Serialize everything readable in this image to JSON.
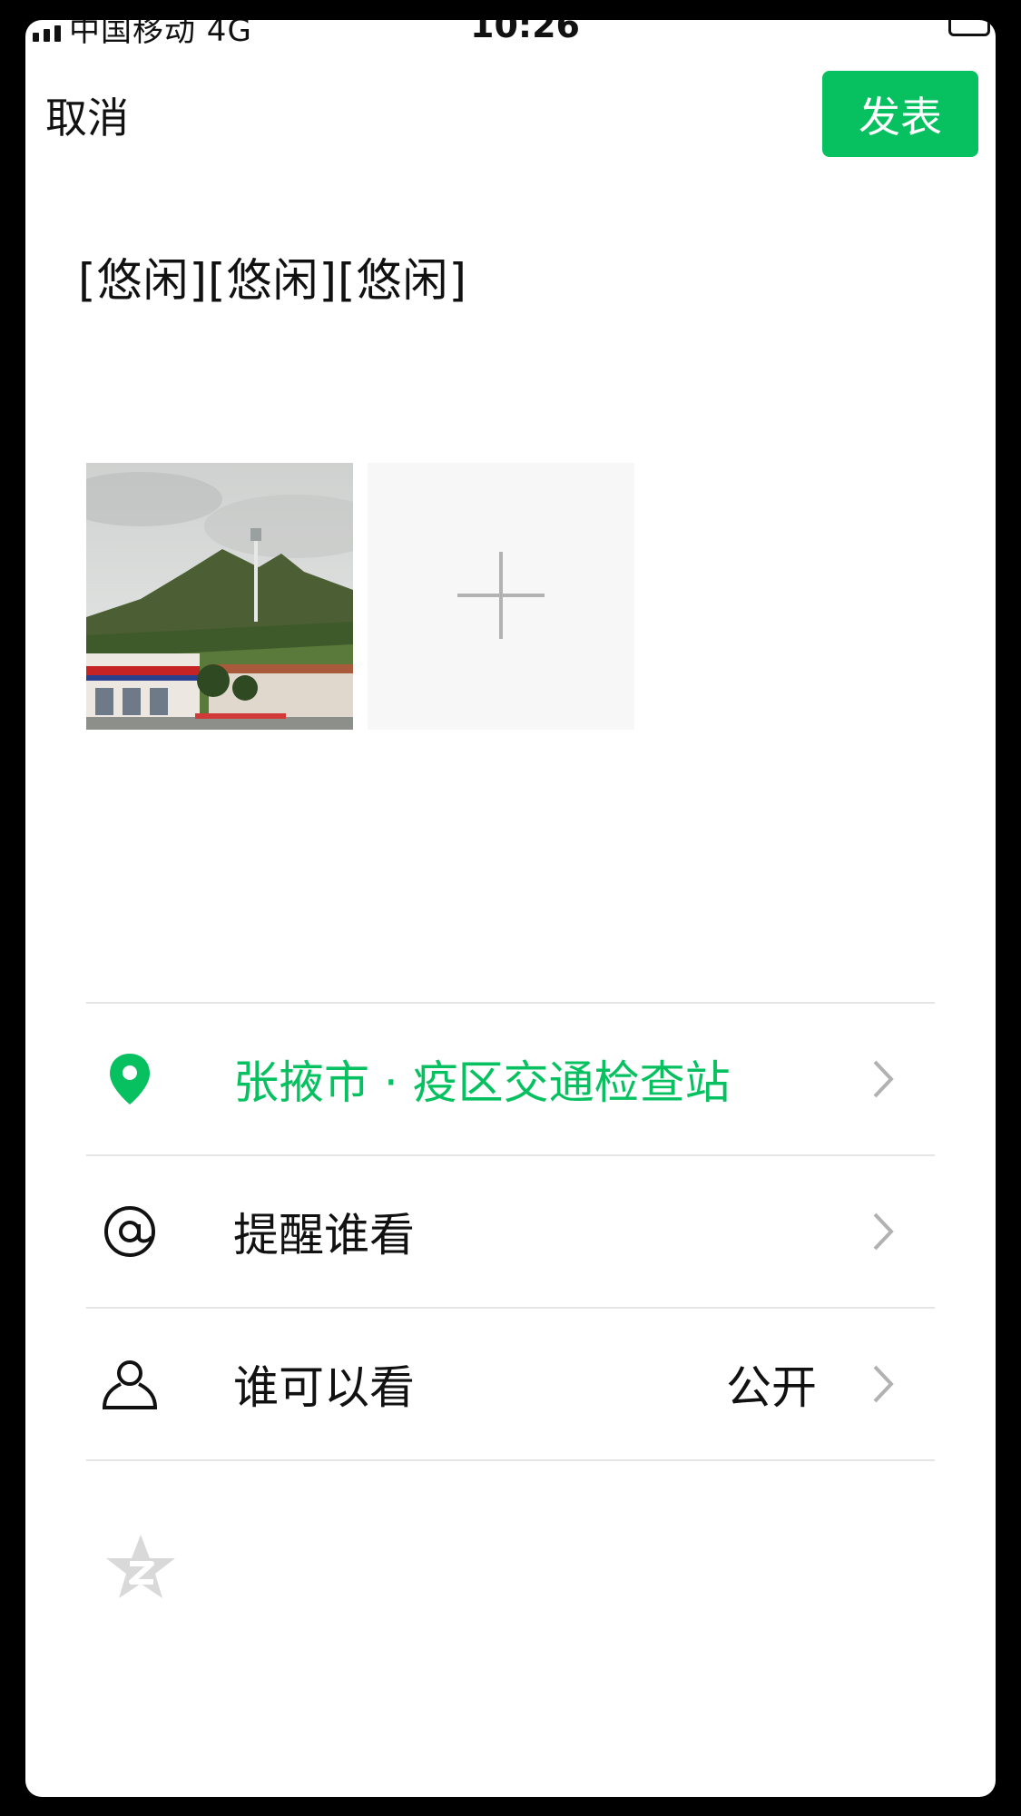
{
  "status_bar": {
    "carrier": "中国移动  4G",
    "time": "10:26"
  },
  "nav": {
    "cancel_label": "取消",
    "publish_label": "发表",
    "publish_color": "#07c160"
  },
  "post": {
    "text": "[悠闲][悠闲][悠闲]"
  },
  "media": {
    "photo_icon": "landscape-photo",
    "add_icon": "plus-icon"
  },
  "options": {
    "location": {
      "icon": "location-pin-icon",
      "label": "张掖市 · 疫区交通检查站"
    },
    "mention": {
      "icon": "at-icon",
      "label": "提醒谁看"
    },
    "visibility": {
      "icon": "person-icon",
      "label": "谁可以看",
      "value": "公开"
    }
  },
  "share": {
    "qzone_icon": "qzone-star-icon"
  }
}
